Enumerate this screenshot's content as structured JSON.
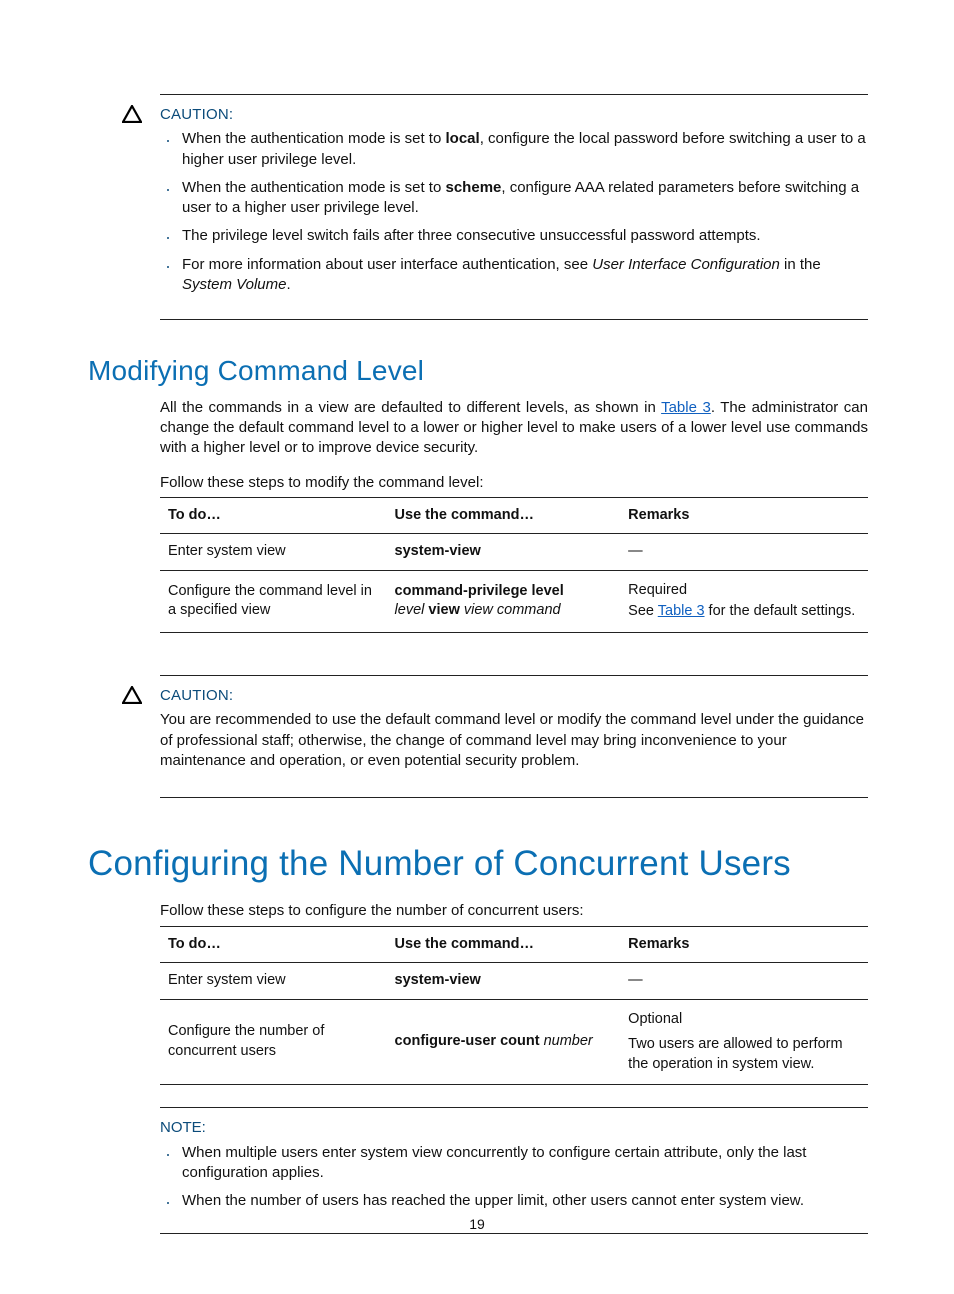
{
  "caution1": {
    "label": "CAUTION:",
    "b1_pre": "When the authentication mode is set to ",
    "b1_bold": "local",
    "b1_post": ", configure the local password before switching a user to a higher user privilege level.",
    "b2_pre": "When the authentication mode is set to ",
    "b2_bold": "scheme",
    "b2_post": ", configure AAA related parameters before switching a user to a higher user privilege level.",
    "b3": "The privilege level switch fails after three consecutive unsuccessful password attempts.",
    "b4_pre": "For more information about user interface authentication, see ",
    "b4_i1": "User Interface Configuration",
    "b4_mid": " in the ",
    "b4_i2": "System Volume",
    "b4_post": "."
  },
  "section1": {
    "heading": "Modifying Command Level",
    "para_pre": "All the commands in a view are defaulted to different levels, as shown in ",
    "para_link": "Table 3",
    "para_post": ". The administrator can change the default command level to a lower or higher level to make users of a lower level use commands with a higher level or to improve device security.",
    "steps_intro": "Follow these steps to modify the command level:"
  },
  "table1": {
    "h1": "To do…",
    "h2": "Use the command…",
    "h3": "Remarks",
    "r1c1": "Enter system view",
    "r1c2": "system-view",
    "r1c3": "—",
    "r2c1": "Configure the command level in a specified view",
    "r2c2_b1": "command-privilege level",
    "r2c2_i1": "level",
    "r2c2_b2": "view",
    "r2c2_i2": "view command",
    "r2c3_l1": "Required",
    "r2c3_l2a": "See ",
    "r2c3_link": "Table 3",
    "r2c3_l2b": " for the default settings."
  },
  "caution2": {
    "label": "CAUTION:",
    "body": "You are recommended to use the default command level or modify the command level under the guidance of professional staff; otherwise, the change of command level may bring inconvenience to your maintenance and operation, or even potential security problem."
  },
  "section2": {
    "heading": "Configuring the Number of Concurrent Users",
    "steps_intro": "Follow these steps to configure the number of concurrent users:"
  },
  "table2": {
    "h1": "To do…",
    "h2": "Use the command…",
    "h3": "Remarks",
    "r1c1": "Enter system view",
    "r1c2": "system-view",
    "r1c3": "—",
    "r2c1": "Configure the number of concurrent users",
    "r2c2_b": "configure-user count",
    "r2c2_i": "number",
    "r2c3_l1": "Optional",
    "r2c3_l2": "Two users are allowed to perform the operation in system view."
  },
  "note": {
    "label": "NOTE:",
    "b1": "When multiple users enter system view concurrently to configure certain attribute, only the last configuration applies.",
    "b2": "When the number of users has reached the upper limit, other users cannot enter system view."
  },
  "page_number": "19",
  "chart_data": [
    {
      "type": "table",
      "title": "Follow these steps to modify the command level:",
      "columns": [
        "To do…",
        "Use the command…",
        "Remarks"
      ],
      "rows": [
        [
          "Enter system view",
          "system-view",
          "—"
        ],
        [
          "Configure the command level in a specified view",
          "command-privilege level level view view command",
          "Required. See Table 3 for the default settings."
        ]
      ]
    },
    {
      "type": "table",
      "title": "Follow these steps to configure the number of concurrent users:",
      "columns": [
        "To do…",
        "Use the command…",
        "Remarks"
      ],
      "rows": [
        [
          "Enter system view",
          "system-view",
          "—"
        ],
        [
          "Configure the number of concurrent users",
          "configure-user count number",
          "Optional. Two users are allowed to perform the operation in system view."
        ]
      ]
    }
  ]
}
